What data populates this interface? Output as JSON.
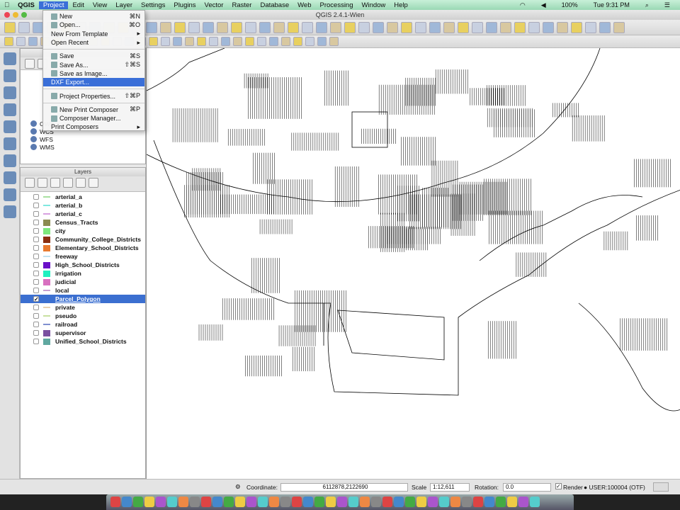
{
  "menubar": {
    "apple": "",
    "app": "QGIS",
    "items": [
      "Project",
      "Edit",
      "View",
      "Layer",
      "Settings",
      "Plugins",
      "Vector",
      "Raster",
      "Database",
      "Web",
      "Processing",
      "Window",
      "Help"
    ],
    "status": {
      "battery": "100%",
      "clock": "Tue 9:31 PM"
    }
  },
  "window": {
    "title": "QGIS 2.4.1-Wien"
  },
  "project_menu": [
    {
      "label": "New",
      "shortcut": "⌘N",
      "icon": "new-file-icon"
    },
    {
      "label": "Open...",
      "shortcut": "⌘O",
      "icon": "folder-icon"
    },
    {
      "label": "New From Template",
      "submenu": "▸"
    },
    {
      "label": "Open Recent",
      "submenu": "▸"
    },
    {
      "sep": true
    },
    {
      "label": "Save",
      "shortcut": "⌘S",
      "icon": "save-icon"
    },
    {
      "label": "Save As...",
      "shortcut": "⇧⌘S",
      "icon": "save-as-icon"
    },
    {
      "label": "Save as Image...",
      "icon": "save-image-icon"
    },
    {
      "label": "DXF Export...",
      "highlighted": true
    },
    {
      "sep": true
    },
    {
      "label": "Project Properties...",
      "shortcut": "⇧⌘P",
      "icon": "properties-icon"
    },
    {
      "sep": true
    },
    {
      "label": "New Print Composer",
      "shortcut": "⌘P",
      "icon": "composer-icon"
    },
    {
      "label": "Composer Manager...",
      "icon": "composer-manager-icon"
    },
    {
      "label": "Print Composers",
      "submenu": "▸"
    }
  ],
  "browser": {
    "items": [
      "OWS",
      "WCS",
      "WFS",
      "WMS"
    ]
  },
  "layers_panel": {
    "title": "Layers",
    "layers": [
      {
        "name": "arterial_a",
        "kind": "line",
        "color": "#a8e0a0",
        "checked": false
      },
      {
        "name": "arterial_b",
        "kind": "line",
        "color": "#80e8e0",
        "checked": false
      },
      {
        "name": "arterial_c",
        "kind": "line",
        "color": "#d8a0e0",
        "checked": false
      },
      {
        "name": "Census_Tracts",
        "kind": "fill",
        "color": "#8b8b50",
        "checked": false
      },
      {
        "name": "city",
        "kind": "fill",
        "color": "#7de87d",
        "checked": false
      },
      {
        "name": "Community_College_Districts",
        "kind": "fill",
        "color": "#8b2f10",
        "checked": false
      },
      {
        "name": "Elementary_School_Districts",
        "kind": "fill",
        "color": "#e87a30",
        "checked": false
      },
      {
        "name": "freeway",
        "kind": "line",
        "color": "#c0e0f0",
        "checked": false
      },
      {
        "name": "High_School_Districts",
        "kind": "fill",
        "color": "#6a10c8",
        "checked": false
      },
      {
        "name": "irrigation",
        "kind": "fill",
        "color": "#20f0c0",
        "checked": false
      },
      {
        "name": "judicial",
        "kind": "fill",
        "color": "#d870c0",
        "checked": false
      },
      {
        "name": "local",
        "kind": "line",
        "color": "#c8a0d0",
        "checked": false
      },
      {
        "name": "Parcel_Polygon",
        "kind": "fill",
        "color": "#3b6fd0",
        "checked": true,
        "selected": true
      },
      {
        "name": "private",
        "kind": "line",
        "color": "#e8d0b0",
        "checked": false
      },
      {
        "name": "pseudo",
        "kind": "line",
        "color": "#c8e0a0",
        "checked": false
      },
      {
        "name": "railroad",
        "kind": "line",
        "color": "#8090d0",
        "checked": false
      },
      {
        "name": "supervisor",
        "kind": "fill",
        "color": "#7a50a0",
        "checked": false
      },
      {
        "name": "Unified_School_Districts",
        "kind": "fill",
        "color": "#60a8a0",
        "checked": false
      }
    ]
  },
  "statusbar": {
    "coordinate_label": "Coordinate:",
    "coordinate": "6112878,2122690",
    "scale_label": "Scale",
    "scale": "1:12,611",
    "rotation_label": "Rotation:",
    "rotation": "0.0",
    "render_label": "Render",
    "render_checked": true,
    "crs": "USER:100004 (OTF)"
  }
}
